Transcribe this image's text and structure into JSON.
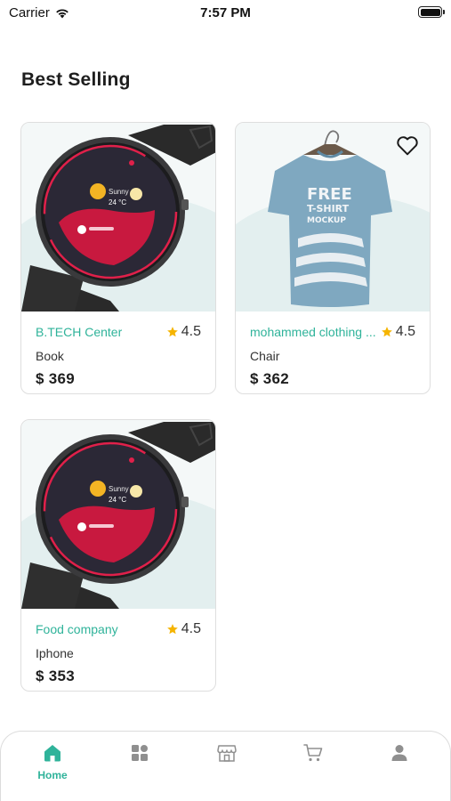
{
  "status_bar": {
    "carrier": "Carrier",
    "time": "7:57 PM"
  },
  "section": {
    "title": "Best Selling"
  },
  "products": [
    {
      "vendor": "B.TECH Center",
      "rating": "4.5",
      "category": "Book",
      "price": "$ 369",
      "image": "smartwatch",
      "favorite_visible": false
    },
    {
      "vendor": "mohammed clothing ...",
      "rating": "4.5",
      "category": "Chair",
      "price": "$ 362",
      "image": "tshirt",
      "favorite_visible": true
    },
    {
      "vendor": "Food company",
      "rating": "4.5",
      "category": "Iphone",
      "price": "$ 353",
      "image": "smartwatch",
      "favorite_visible": false
    }
  ],
  "tshirt_print": "FREE\nT-SHIRT\nMOCKUP",
  "watch_screen": {
    "temp": "24 °C",
    "day": "Sunny"
  },
  "bottom_nav": {
    "items": [
      {
        "label": "Home",
        "icon": "home-icon",
        "active": true
      },
      {
        "label": "",
        "icon": "grid-icon",
        "active": false
      },
      {
        "label": "",
        "icon": "store-icon",
        "active": false
      },
      {
        "label": "",
        "icon": "cart-icon",
        "active": false
      },
      {
        "label": "",
        "icon": "user-icon",
        "active": false
      }
    ]
  },
  "colors": {
    "accent": "#2fb39a",
    "star": "#f5b400",
    "icon_inactive": "#8f8f8f"
  }
}
